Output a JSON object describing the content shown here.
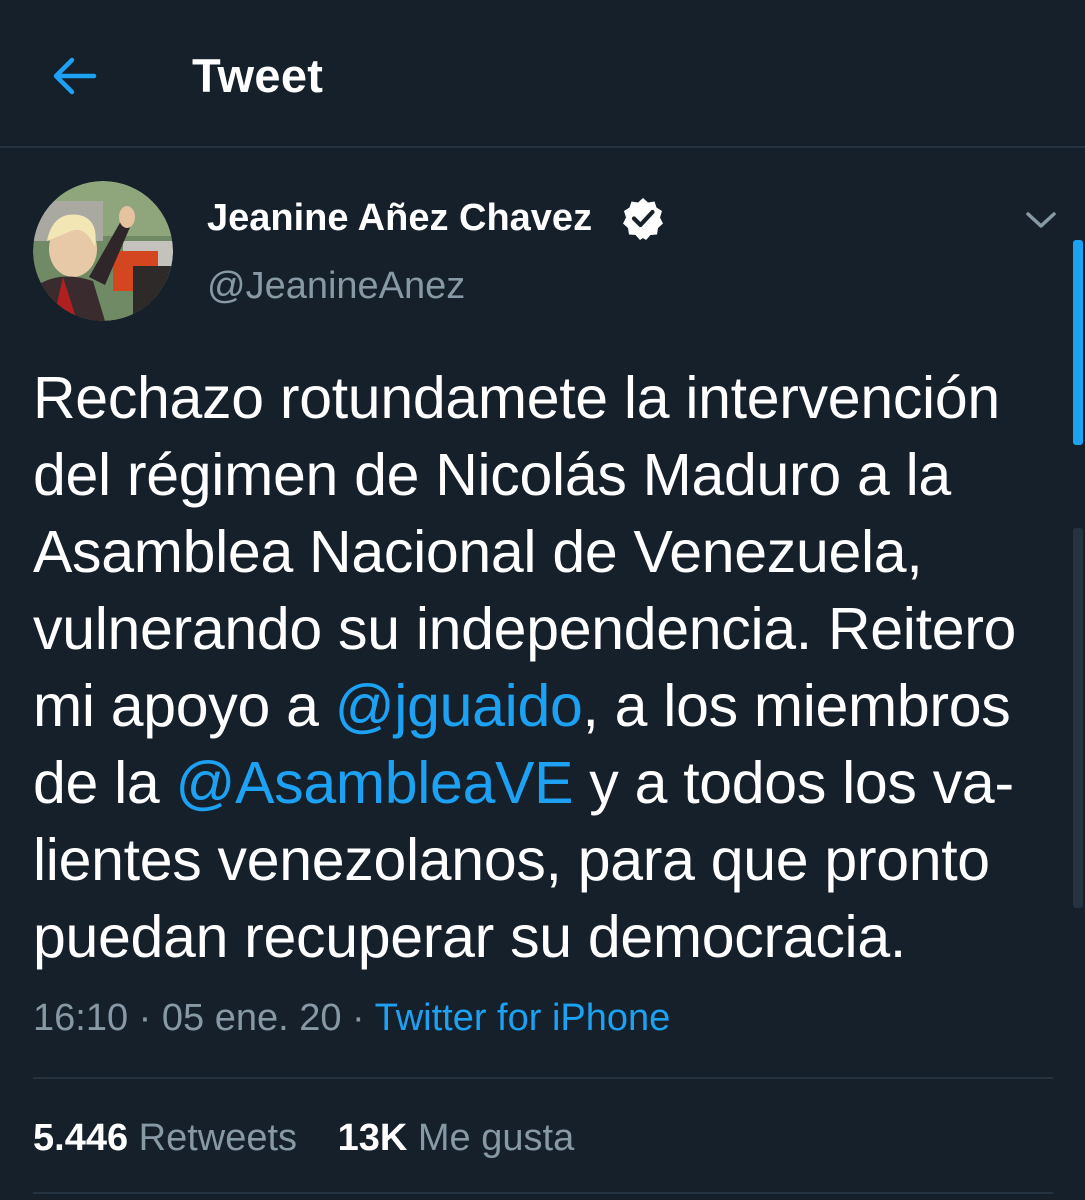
{
  "header": {
    "title": "Tweet",
    "back_icon": "arrow-left-icon"
  },
  "colors": {
    "background": "#15202b",
    "accent": "#1da1f2",
    "secondary_text": "#8899a6",
    "divider": "#253341"
  },
  "author": {
    "name": "Jeanine Añez Chavez",
    "handle": "@JeanineAnez",
    "verified": true,
    "verified_icon": "verified-badge-icon",
    "menu_icon": "chevron-down-icon"
  },
  "tweet": {
    "lines": [
      [
        "Rechazo rotundamete la intervención"
      ],
      [
        "del régimen de Nicolás Maduro a la"
      ],
      [
        "Asamblea Nacional de Venezuela,"
      ],
      [
        "vulnerando su independencia. Reitero"
      ],
      [
        "mi apoyo a ",
        "@jguaido",
        ", a los miembros"
      ],
      [
        "de la ",
        "@AsambleaVE",
        " y a todos los va-"
      ],
      [
        "lientes venezolanos, para que pronto"
      ],
      [
        "puedan recuperar su democracia."
      ]
    ],
    "mentions": [
      "@jguaido",
      "@AsambleaVE"
    ],
    "time": "16:10",
    "separator": "·",
    "date": "05 ene. 20",
    "source": "Twitter for iPhone"
  },
  "stats": {
    "retweets_count": "5.446",
    "retweets_label": "Retweets",
    "likes_count": "13K",
    "likes_label": "Me gusta"
  }
}
